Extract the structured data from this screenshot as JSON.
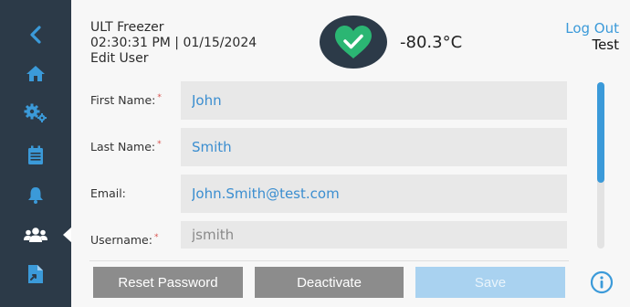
{
  "header": {
    "device_name": "ULT Freezer",
    "datetime": "02:30:31 PM | 01/15/2024",
    "page_title": "Edit User",
    "temperature": "-80.3°C",
    "status_icon": "check-icon",
    "logout_label": "Log Out",
    "user_name": "Test"
  },
  "sidebar": {
    "items": [
      {
        "icon": "chevron-left-icon"
      },
      {
        "icon": "home-icon"
      },
      {
        "icon": "gears-icon"
      },
      {
        "icon": "calendar-icon"
      },
      {
        "icon": "bell-icon"
      },
      {
        "icon": "users-icon",
        "active": true
      },
      {
        "icon": "file-export-icon"
      }
    ]
  },
  "form": {
    "fields": [
      {
        "label": "First Name:",
        "required": "*",
        "value": "John"
      },
      {
        "label": "Last Name:",
        "required": "*",
        "value": "Smith"
      },
      {
        "label": "Email:",
        "required": "",
        "value": "John.Smith@test.com"
      },
      {
        "label": "Username:",
        "required": "*",
        "value": "jsmith"
      }
    ]
  },
  "buttons": {
    "reset_password": "Reset Password",
    "deactivate": "Deactivate",
    "save": "Save"
  },
  "colors": {
    "sidebar": "#2c3a48",
    "accent": "#3b9ad9",
    "status_ok": "#2bb673",
    "button_gray": "#8c8c8c",
    "button_disabled": "#a9d2f0"
  }
}
